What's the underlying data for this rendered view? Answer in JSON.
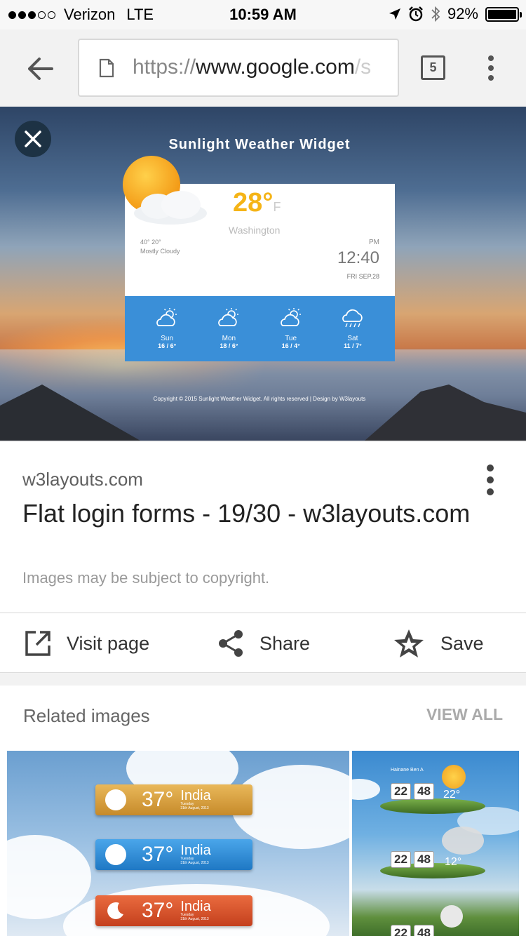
{
  "status_bar": {
    "carrier": "Verizon",
    "network": "LTE",
    "time": "10:59 AM",
    "battery": "92%",
    "battery_level": 0.92
  },
  "toolbar": {
    "url_scheme": "https://",
    "url_host": "www.google.com",
    "url_rest": "/s",
    "tab_count": "5"
  },
  "image": {
    "widget_title": "Sunlight Weather Widget",
    "temperature": "28°",
    "temp_unit": "F",
    "city": "Washington",
    "range": "40° 20°",
    "condition": "Mostly Cloudy",
    "ampm": "PM",
    "clock": "12:40",
    "date": "FRI SEP.28",
    "forecast": [
      {
        "day": "Sun",
        "temps": "16 / 6°"
      },
      {
        "day": "Mon",
        "temps": "18 / 6°"
      },
      {
        "day": "Tue",
        "temps": "16 / 4°"
      },
      {
        "day": "Sat",
        "temps": "11 / 7°"
      }
    ],
    "copyright": "Copyright © 2015 Sunlight Weather Widget. All rights reserved | Design by W3layouts"
  },
  "result": {
    "source": "w3layouts.com",
    "title": "Flat login forms - 19/30 - w3layouts.com",
    "note": "Images may be subject to copyright."
  },
  "actions": {
    "visit": "Visit page",
    "share": "Share",
    "save": "Save"
  },
  "related": {
    "header": "Related images",
    "view_all": "VIEW ALL",
    "thumb1_items": [
      {
        "temp": "37°",
        "city": "India",
        "sub1": "Tuesday",
        "sub2": "31th August, 2013",
        "color": "#d9a23a"
      },
      {
        "temp": "37°",
        "city": "India",
        "sub1": "Tuesday",
        "sub2": "31th August, 2013",
        "color": "#2f8fd8"
      },
      {
        "temp": "37°",
        "city": "India",
        "sub1": "Tuesday",
        "sub2": "31th August, 2013",
        "color": "#d8552e"
      }
    ],
    "thumb2_items": [
      {
        "city": "Hainane Ben A",
        "hour": "22",
        "min": "48",
        "temp": "22°"
      },
      {
        "city": "",
        "hour": "22",
        "min": "48",
        "temp": "12°"
      },
      {
        "city": "",
        "hour": "22",
        "min": "48",
        "temp": ""
      }
    ]
  }
}
